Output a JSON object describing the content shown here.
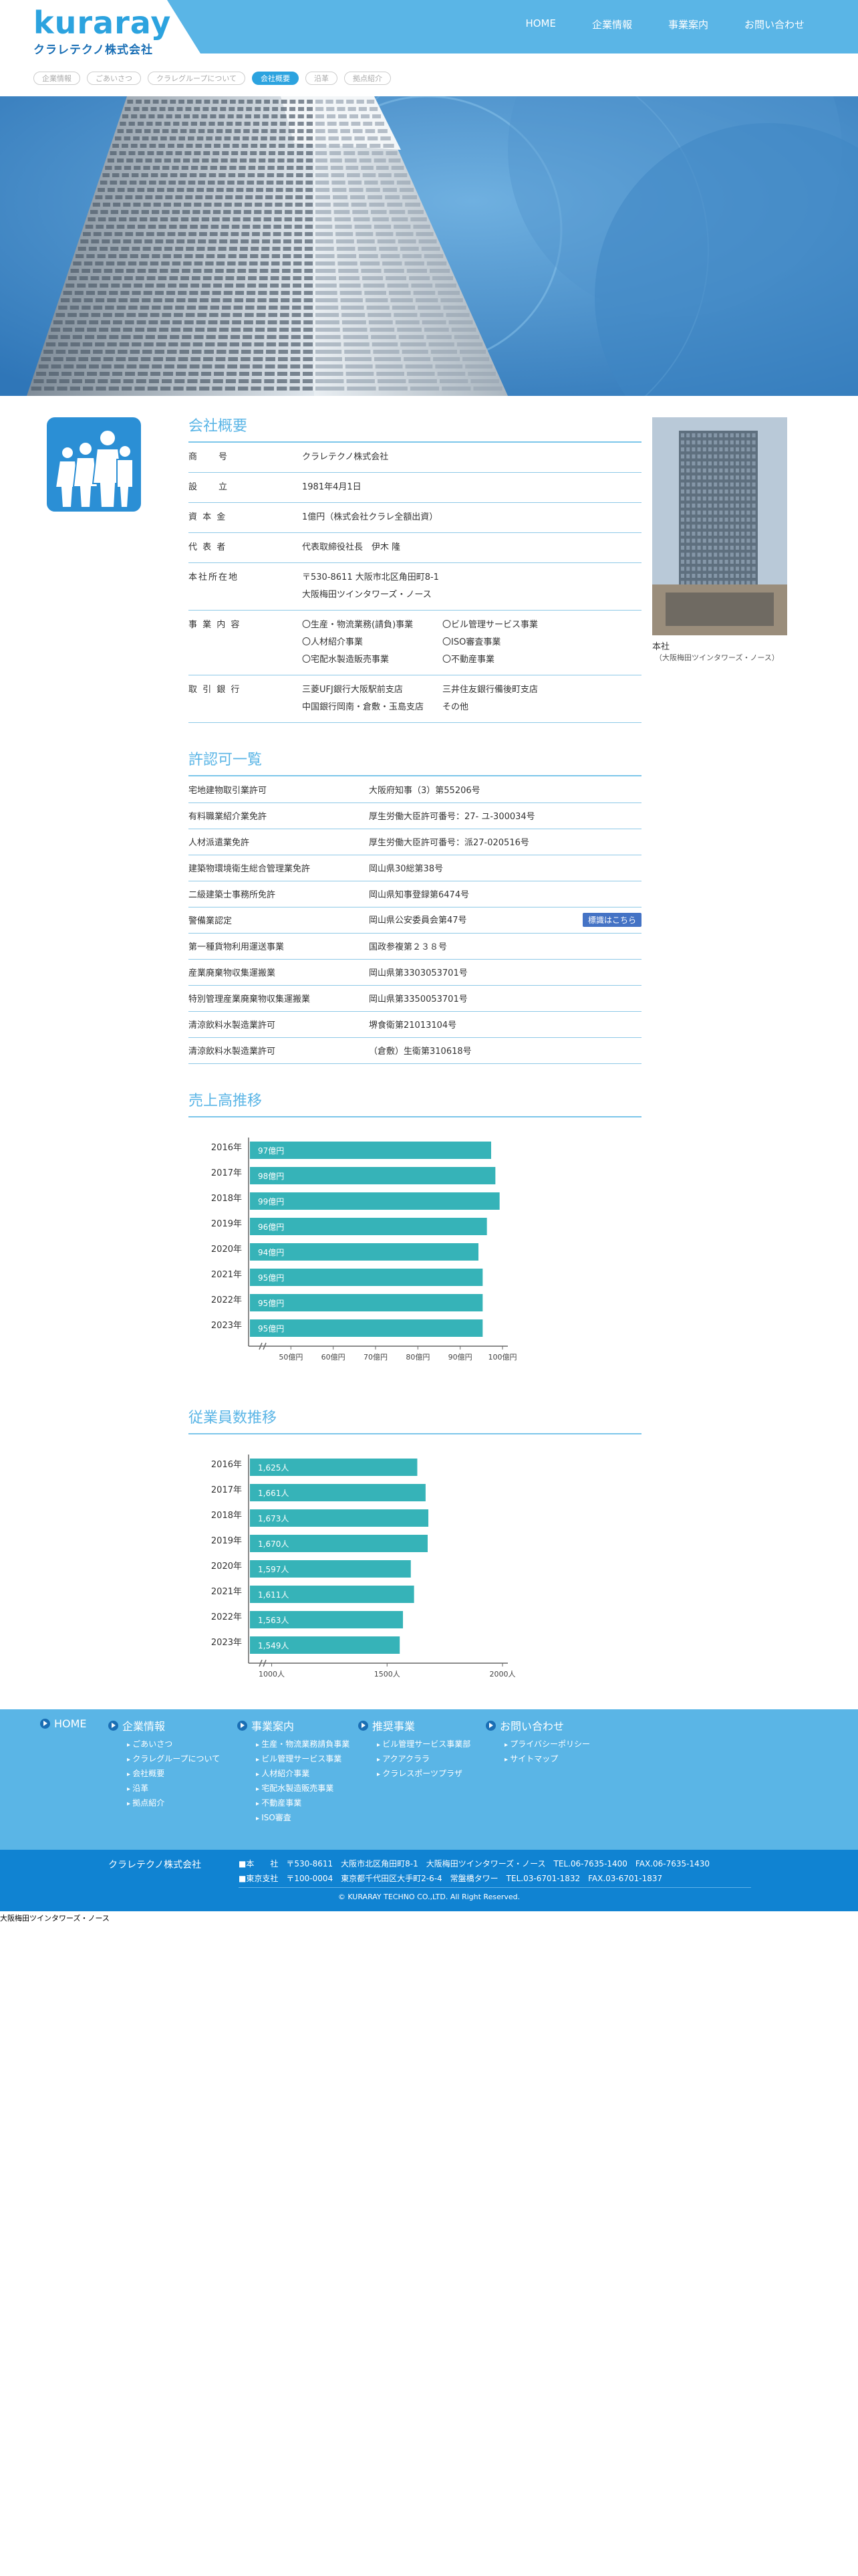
{
  "header": {
    "logo_word": "kuraray",
    "company": "クラレテクノ株式会社",
    "nav": [
      "HOME",
      "企業情報",
      "事業案内",
      "お問い合わせ"
    ]
  },
  "tabs": [
    {
      "label": "企業情報",
      "active": false
    },
    {
      "label": "ごあいさつ",
      "active": false
    },
    {
      "label": "クラレグループについて",
      "active": false
    },
    {
      "label": "会社概要",
      "active": true
    },
    {
      "label": "沿革",
      "active": false
    },
    {
      "label": "拠点紹介",
      "active": false
    }
  ],
  "profile": {
    "title": "会社概要",
    "rows": [
      {
        "label": "商　　号",
        "value": "クラレテクノ株式会社"
      },
      {
        "label": "設　　立",
        "value": "1981年4月1日"
      },
      {
        "label": "資 本 金",
        "value": "1億円（株式会社クラレ全額出資）"
      },
      {
        "label": "代 表 者",
        "value": "代表取締役社長　伊木 隆"
      },
      {
        "label": "本社所在地",
        "value": "〒530-8611 大阪市北区角田町8-1",
        "value2": "大阪梅田ツインタワーズ・ノース"
      }
    ],
    "business_label": "事 業 内 容",
    "business": [
      "〇生産・物流業務(請負)事業",
      "〇ビル管理サービス事業",
      "〇人材紹介事業",
      "〇ISO審査事業",
      "〇宅配水製造販売事業",
      "〇不動産事業"
    ],
    "bank_label": "取 引 銀 行",
    "banks": [
      "三菱UFJ銀行大阪駅前支店",
      "三井住友銀行備後町支店",
      "中国銀行岡南・倉敷・玉島支店",
      "その他"
    ]
  },
  "photo": {
    "caption": "本社",
    "sub": "（大阪梅田ツインタワーズ・ノース）"
  },
  "licenses": {
    "title": "許認可一覧",
    "badge": "標識はこちら",
    "rows": [
      {
        "label": "宅地建物取引業許可",
        "value": "大阪府知事（3）第55206号"
      },
      {
        "label": "有料職業紹介業免許",
        "value": "厚生労働大臣許可番号：27- ユ-300034号"
      },
      {
        "label": "人材派遣業免許",
        "value": "厚生労働大臣許可番号：派27-020516号"
      },
      {
        "label": "建築物環境衛生総合管理業免許",
        "value": "岡山県30総第38号"
      },
      {
        "label": "二級建築士事務所免許",
        "value": "岡山県知事登録第6474号"
      },
      {
        "label": "警備業認定",
        "value": "岡山県公安委員会第47号",
        "badge": true
      },
      {
        "label": "第一種貨物利用運送事業",
        "value": "国政参複第２３８号"
      },
      {
        "label": "産業廃棄物収集運搬業",
        "value": "岡山県第3303053701号"
      },
      {
        "label": "特別管理産業廃棄物収集運搬業",
        "value": "岡山県第3350053701号"
      },
      {
        "label": "清涼飲料水製造業許可",
        "value": "堺食衛第21013104号"
      },
      {
        "label": "清涼飲料水製造業許可",
        "value": "（倉敷）生衛第310618号"
      }
    ]
  },
  "colors": {
    "accent": "#5ab5e6",
    "bar": "#36b3b8",
    "footer": "#1083d2"
  },
  "chart_data": [
    {
      "type": "bar",
      "title": "売上高推移",
      "categories": [
        "2016年",
        "2017年",
        "2018年",
        "2019年",
        "2020年",
        "2021年",
        "2022年",
        "2023年"
      ],
      "values": [
        97,
        98,
        99,
        96,
        94,
        95,
        95,
        95
      ],
      "data_labels": [
        "97億円",
        "98億円",
        "99億円",
        "96億円",
        "94億円",
        "95億円",
        "95億円",
        "95億円"
      ],
      "xticks": [
        "50億円",
        "60億円",
        "70億円",
        "80億円",
        "90億円",
        "100億円"
      ],
      "xtick_values": [
        50,
        60,
        70,
        80,
        90,
        100
      ],
      "xlim": [
        40,
        100
      ],
      "axis_break": true
    },
    {
      "type": "bar",
      "title": "従業員数推移",
      "categories": [
        "2016年",
        "2017年",
        "2018年",
        "2019年",
        "2020年",
        "2021年",
        "2022年",
        "2023年"
      ],
      "values": [
        1625,
        1661,
        1673,
        1670,
        1597,
        1611,
        1563,
        1549
      ],
      "data_labels": [
        "1,625人",
        "1,661人",
        "1,673人",
        "1,670人",
        "1,597人",
        "1,611人",
        "1,563人",
        "1,549人"
      ],
      "xticks": [
        "1000人",
        "1500人",
        "2000人"
      ],
      "xtick_values": [
        1000,
        1500,
        2000
      ],
      "xlim": [
        900,
        2000
      ],
      "axis_break": true
    }
  ],
  "footer_nav": [
    {
      "head": "HOME",
      "items": []
    },
    {
      "head": "企業情報",
      "items": [
        "ごあいさつ",
        "クラレグループについて",
        "会社概要",
        "沿革",
        "拠点紹介"
      ]
    },
    {
      "head": "事業案内",
      "items": [
        "生産・物流業務請負事業",
        "ビル管理サービス事業",
        "人材紹介事業",
        "宅配水製造販売事業",
        "不動産事業",
        "ISO審査"
      ]
    },
    {
      "head": "推奨事業",
      "items": [
        "ビル管理サービス事業部",
        "アクアクララ",
        "クラレスポーツプラザ"
      ]
    },
    {
      "head": "お問い合わせ",
      "items": [
        "プライバシーポリシー",
        "サイトマップ"
      ]
    }
  ],
  "footer": {
    "company": "クラレテクノ株式会社",
    "addr1": "■本　　社　〒530-8611　大阪市北区角田町8-1　大阪梅田ツインタワーズ・ノース　TEL.06-7635-1400　FAX.06-7635-1430",
    "addr2": "■東京支社　〒100-0004　東京都千代田区大手町2-6-4　常盤橋タワー　TEL.03-6701-1832　FAX.03-6701-1837",
    "copyright": "© KURARAY TECHNO CO.,LTD. All Right Reserved."
  },
  "alt_text": "大阪梅田ツインタワーズ・ノース"
}
